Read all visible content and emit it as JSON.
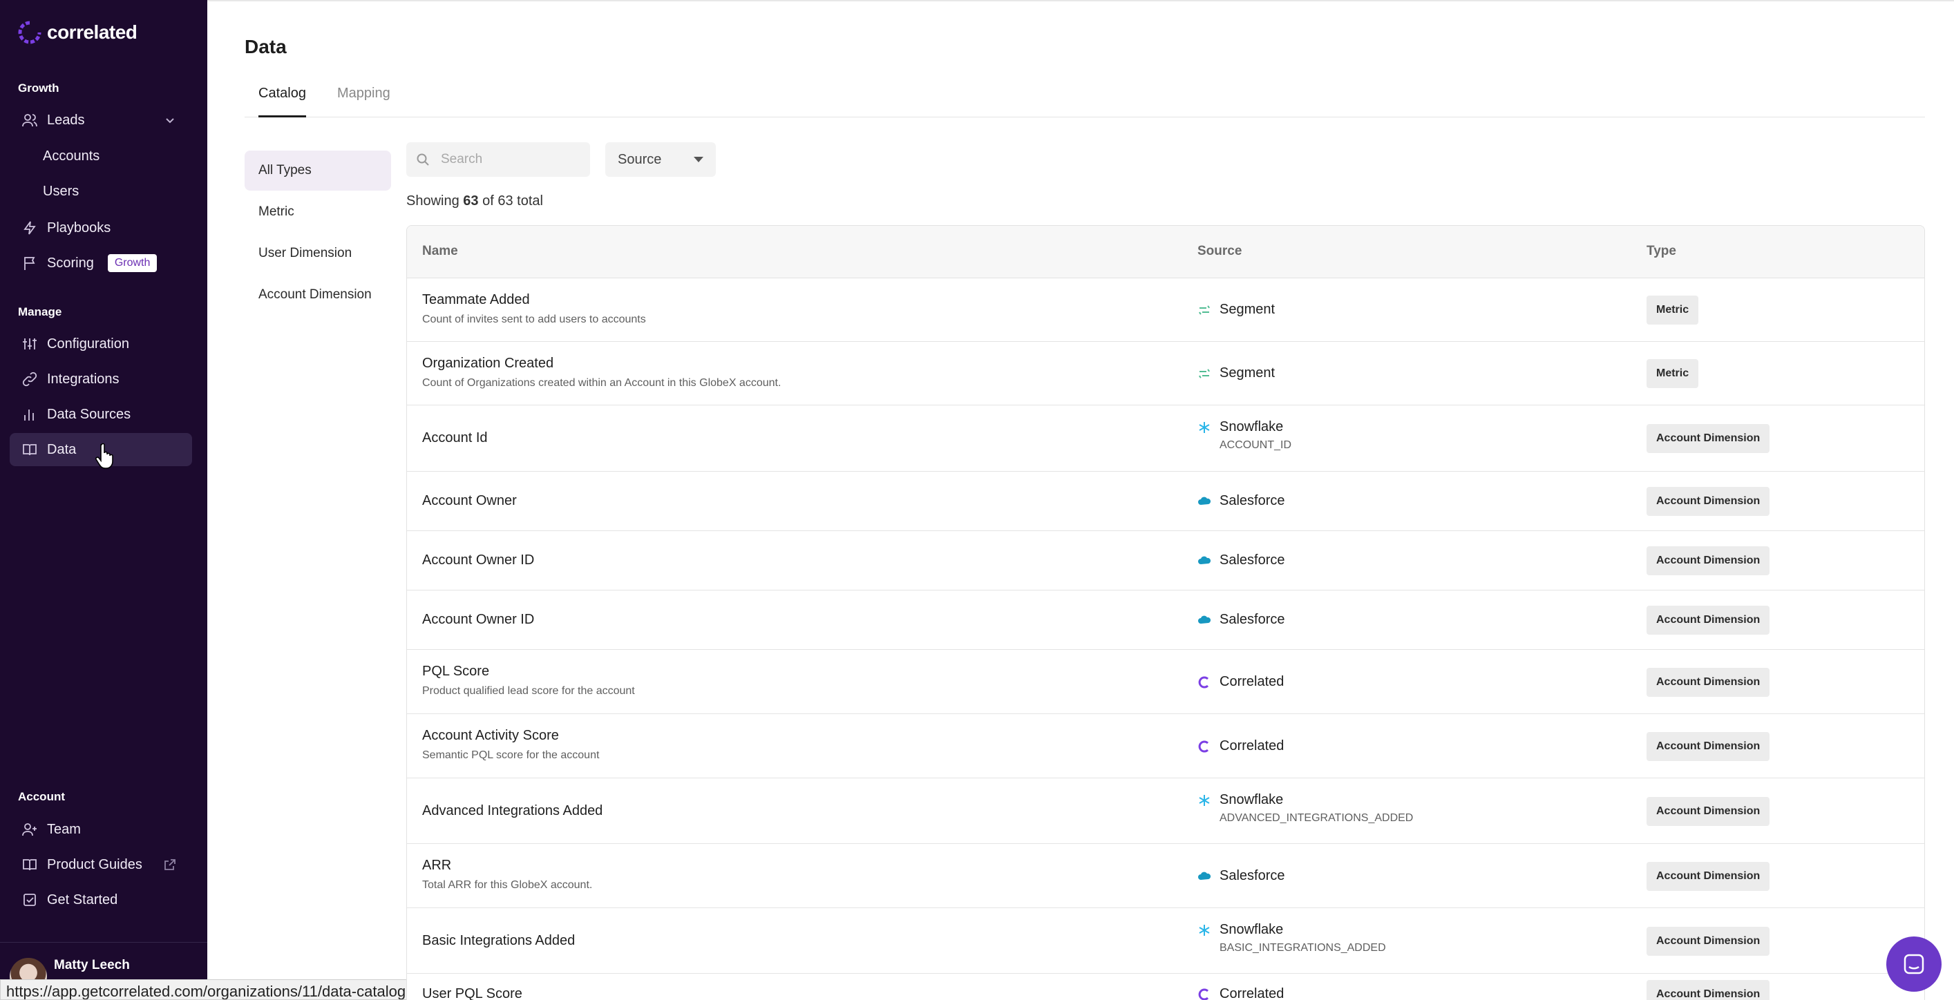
{
  "brand": {
    "name": "correlated"
  },
  "sidebar": {
    "sections": {
      "growth": "Growth",
      "manage": "Manage",
      "account": "Account"
    },
    "growth_items": [
      {
        "label": "Leads",
        "icon": "users-icon"
      },
      {
        "label": "Accounts"
      },
      {
        "label": "Users"
      },
      {
        "label": "Playbooks",
        "icon": "bolt-icon"
      },
      {
        "label": "Scoring",
        "icon": "flag-icon",
        "badge": "Growth"
      }
    ],
    "manage_items": [
      {
        "label": "Configuration",
        "icon": "sliders-icon"
      },
      {
        "label": "Integrations",
        "icon": "link-icon"
      },
      {
        "label": "Data Sources",
        "icon": "bar-chart-icon"
      },
      {
        "label": "Data",
        "icon": "book-icon"
      }
    ],
    "account_items": [
      {
        "label": "Team",
        "icon": "user-plus-icon"
      },
      {
        "label": "Product Guides",
        "icon": "book-icon"
      },
      {
        "label": "Get Started",
        "icon": "checkbox-icon"
      }
    ],
    "user": {
      "name": "Matty Leech"
    }
  },
  "status_url": "https://app.getcorrelated.com/organizations/11/data-catalog",
  "page": {
    "title": "Data",
    "tabs": [
      "Catalog",
      "Mapping"
    ]
  },
  "filters": [
    "All Types",
    "Metric",
    "User Dimension",
    "Account Dimension"
  ],
  "search": {
    "placeholder": "Search"
  },
  "source_select": {
    "value": "Source"
  },
  "showing": {
    "prefix": "Showing",
    "count": "63",
    "middle": "of 63 total"
  },
  "table": {
    "columns": [
      "Name",
      "Source",
      "Type"
    ],
    "rows": [
      {
        "name": "Teammate Added",
        "desc": "Count of invites sent to add users to accounts",
        "source": "Segment",
        "source_sub": "",
        "type": "Metric"
      },
      {
        "name": "Organization Created",
        "desc": "Count of Organizations created within an Account in this GlobeX account.",
        "source": "Segment",
        "source_sub": "",
        "type": "Metric"
      },
      {
        "name": "Account Id",
        "desc": "",
        "source": "Snowflake",
        "source_sub": "ACCOUNT_ID",
        "type": "Account Dimension"
      },
      {
        "name": "Account Owner",
        "desc": "",
        "source": "Salesforce",
        "source_sub": "",
        "type": "Account Dimension"
      },
      {
        "name": "Account Owner ID",
        "desc": "",
        "source": "Salesforce",
        "source_sub": "",
        "type": "Account Dimension"
      },
      {
        "name": "Account Owner ID",
        "desc": "",
        "source": "Salesforce",
        "source_sub": "",
        "type": "Account Dimension"
      },
      {
        "name": "PQL Score",
        "desc": "Product qualified lead score for the account",
        "source": "Correlated",
        "source_sub": "",
        "type": "Account Dimension"
      },
      {
        "name": "Account Activity Score",
        "desc": "Semantic PQL score for the account",
        "source": "Correlated",
        "source_sub": "",
        "type": "Account Dimension"
      },
      {
        "name": "Advanced Integrations Added",
        "desc": "",
        "source": "Snowflake",
        "source_sub": "ADVANCED_INTEGRATIONS_ADDED",
        "type": "Account Dimension"
      },
      {
        "name": "ARR",
        "desc": "Total ARR for this GlobeX account.",
        "source": "Salesforce",
        "source_sub": "",
        "type": "Account Dimension"
      },
      {
        "name": "Basic Integrations Added",
        "desc": "",
        "source": "Snowflake",
        "source_sub": "BASIC_INTEGRATIONS_ADDED",
        "type": "Account Dimension"
      },
      {
        "name": "User PQL Score",
        "desc": "",
        "source": "Correlated",
        "source_sub": "",
        "type": "Account Dimension"
      }
    ]
  },
  "colors": {
    "sidebar_bg": "#1c0a2e",
    "accent": "#6b39c8",
    "active_filter": "#f1ecf5"
  }
}
